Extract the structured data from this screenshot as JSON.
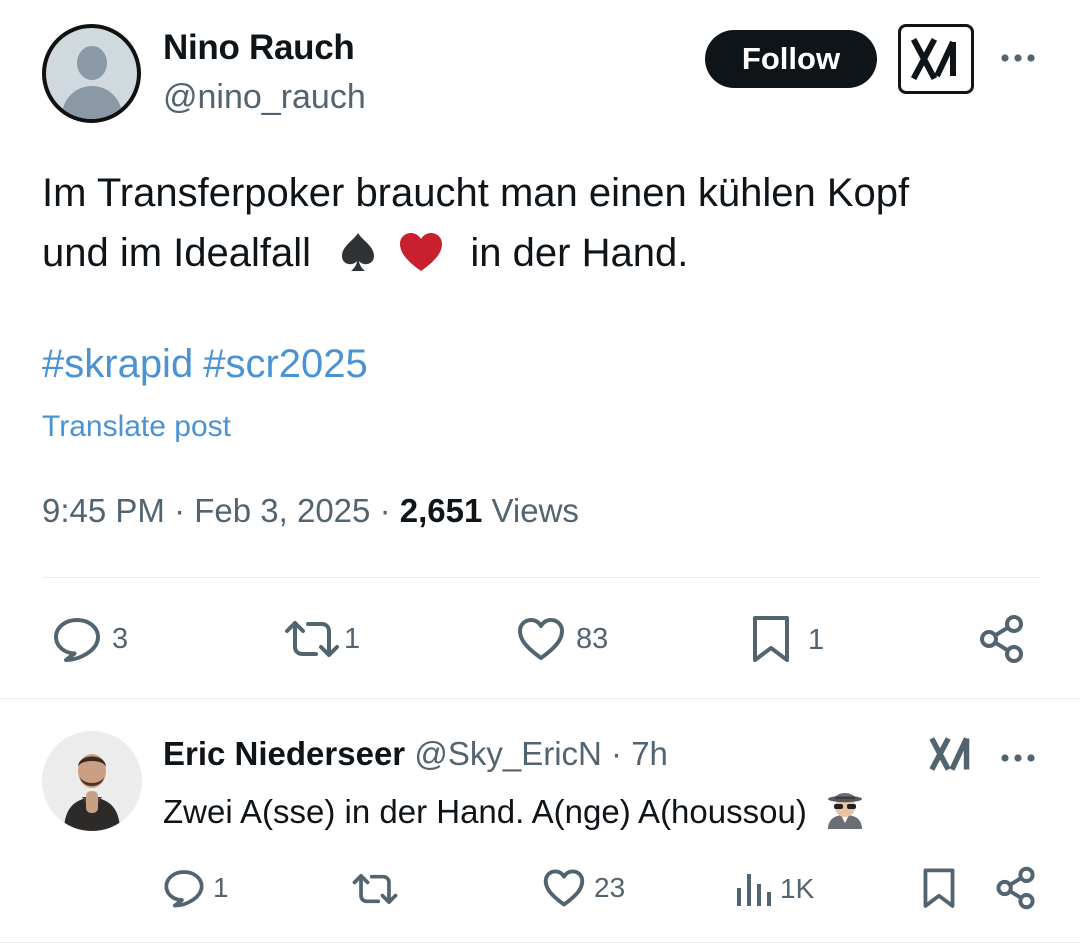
{
  "tweet": {
    "author": {
      "name": "Nino Rauch",
      "handle": "@nino_rauch"
    },
    "follow_label": "Follow",
    "text_line1": "Im Transferpoker braucht man einen kühlen Kopf",
    "text_line2_before": "und im Idealfall",
    "text_line2_after": "in der Hand.",
    "emojis": [
      "spade-suit",
      "red-heart"
    ],
    "hashtags": [
      "#skrapid",
      "#scr2025"
    ],
    "translate_label": "Translate post",
    "time": "9:45 PM",
    "date": "Feb 3, 2025",
    "separator": "·",
    "views_count": "2,651",
    "views_label": "Views",
    "stats": {
      "replies": "3",
      "reposts": "1",
      "likes": "83",
      "bookmarks": "1"
    }
  },
  "reply": {
    "author": {
      "name": "Eric Niederseer",
      "handle": "@Sky_EricN"
    },
    "separator": "·",
    "time": "7h",
    "text": "Zwei A(sse) in der Hand. A(nge) A(houssou)",
    "emoji": "detective",
    "stats": {
      "replies": "1",
      "reposts": "",
      "likes": "23",
      "views": "1K"
    }
  },
  "icons": {
    "reply": "reply-icon",
    "repost": "repost-icon",
    "like": "heart-icon",
    "bookmark": "bookmark-icon",
    "share": "share-icon",
    "views": "views-icon",
    "grok": "grok-icon",
    "more": "more-icon"
  },
  "colors": {
    "link": "#4a93d3",
    "secondary": "#536471",
    "follow_bg": "#0f1419",
    "heart": "#c8202e"
  }
}
